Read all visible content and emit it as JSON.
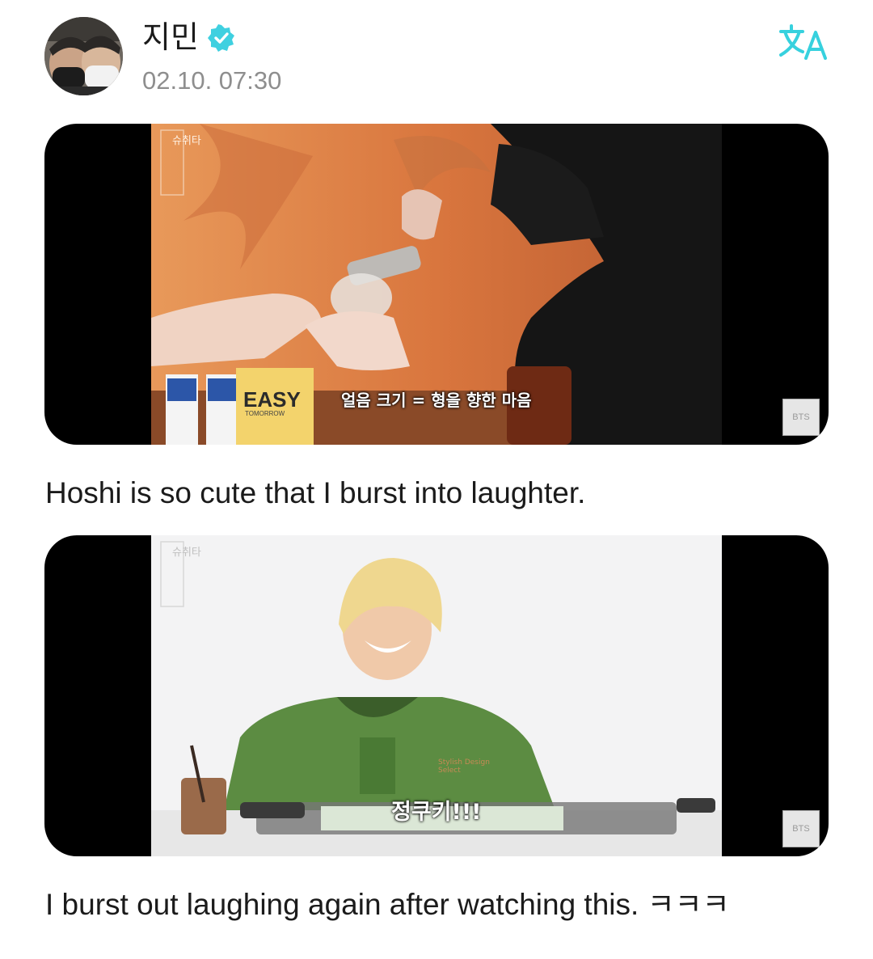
{
  "header": {
    "username": "지민",
    "timestamp": "02.10. 07:30",
    "verified_color": "#3fd0e0",
    "translate_color": "#37d1de"
  },
  "media": [
    {
      "caption": "얼음 크기 = 형을 향한 마음",
      "logo_text": "슈취타",
      "product_text": "EASY",
      "product_subtext": "TOMORROW",
      "watermark": "BTS"
    },
    {
      "caption": "정쿠키!!!",
      "logo_text": "슈취타",
      "hoodie_text": "Stylish Design Select",
      "watermark": "BTS"
    }
  ],
  "posts": [
    {
      "text": "Hoshi is so cute that I burst into laughter."
    },
    {
      "text": "I burst out laughing again after watching this.  ㅋㅋㅋ"
    }
  ]
}
